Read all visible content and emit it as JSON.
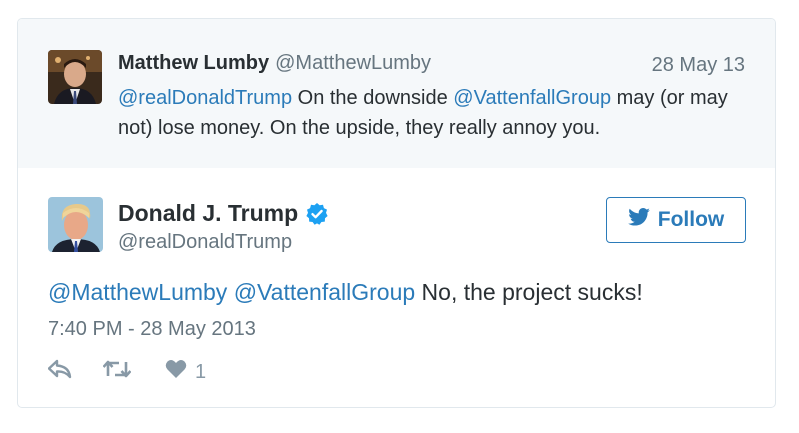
{
  "quoted": {
    "name": "Matthew Lumby",
    "handle": "@MatthewLumby",
    "date": "28 May 13",
    "mention1": "@realDonaldTrump",
    "text1": " On the downside ",
    "mention2": "@VattenfallGroup",
    "text2": " may (or may not) lose money. On the upside, they really annoy you."
  },
  "tweet": {
    "name": "Donald J. Trump",
    "handle": "@realDonaldTrump",
    "follow_label": "Follow",
    "mention1": "@MatthewLumby",
    "space": " ",
    "mention2": "@VattenfallGroup",
    "text": " No, the project sucks!",
    "timestamp": "7:40 PM - 28 May 2013",
    "like_count": "1"
  },
  "colors": {
    "link": "#2b7bb9",
    "text": "#292f33",
    "muted": "#66757f",
    "icon": "#8899a6",
    "verified": "#1da1f2",
    "quoted_bg": "#f5f8fa"
  },
  "icons": [
    "verified-badge-icon",
    "twitter-bird-icon",
    "reply-icon",
    "retweet-icon",
    "heart-icon"
  ]
}
